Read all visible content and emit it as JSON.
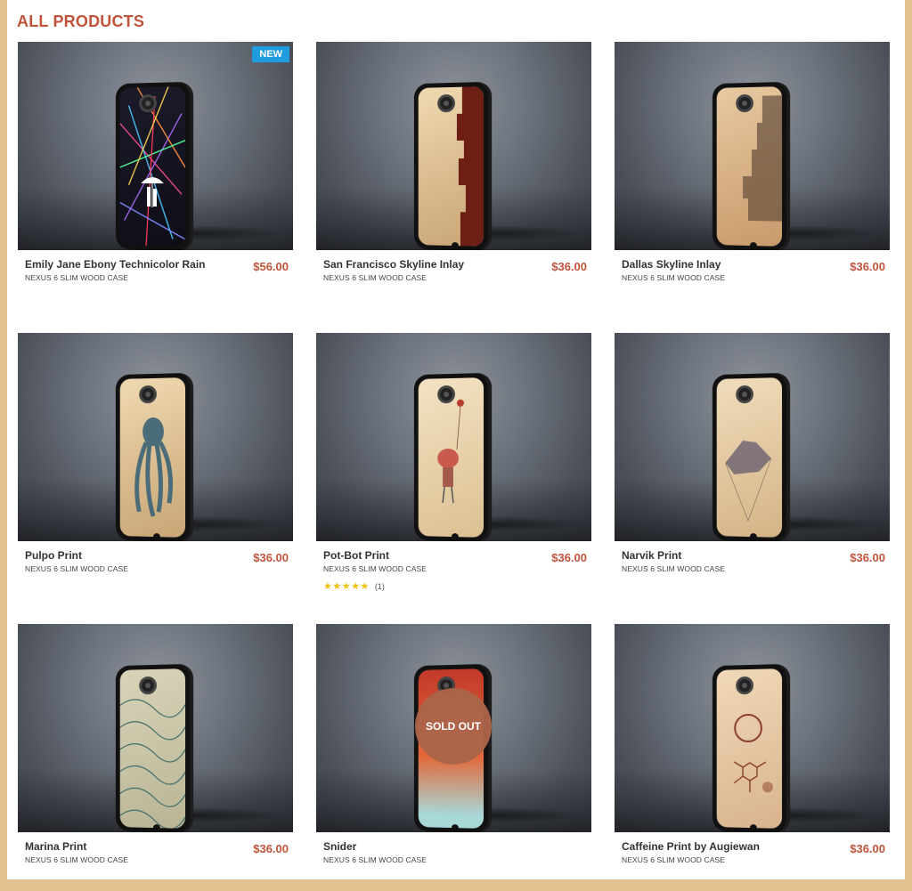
{
  "page": {
    "title": "ALL PRODUCTS"
  },
  "products": [
    {
      "name": "Emily Jane Ebony Technicolor Rain",
      "subtitle": "NEXUS 6 SLIM WOOD CASE",
      "price": "$56.00",
      "badge": "NEW"
    },
    {
      "name": "San Francisco Skyline Inlay",
      "subtitle": "NEXUS 6 SLIM WOOD CASE",
      "price": "$36.00"
    },
    {
      "name": "Dallas Skyline Inlay",
      "subtitle": "NEXUS 6 SLIM WOOD CASE",
      "price": "$36.00"
    },
    {
      "name": "Pulpo Print",
      "subtitle": "NEXUS 6 SLIM WOOD CASE",
      "price": "$36.00"
    },
    {
      "name": "Pot-Bot Print",
      "subtitle": "NEXUS 6 SLIM WOOD CASE",
      "price": "$36.00",
      "rating": {
        "stars": 5,
        "count_text": "(1)"
      }
    },
    {
      "name": "Narvik Print",
      "subtitle": "NEXUS 6 SLIM WOOD CASE",
      "price": "$36.00"
    },
    {
      "name": "Marina Print",
      "subtitle": "NEXUS 6 SLIM WOOD CASE",
      "price": "$36.00"
    },
    {
      "name": "Snider",
      "subtitle": "NEXUS 6 SLIM WOOD CASE",
      "price": "",
      "overlay": "SOLD OUT"
    },
    {
      "name": "Caffeine Print by Augiewan",
      "subtitle": "NEXUS 6 SLIM WOOD CASE",
      "price": "$36.00"
    }
  ],
  "colors": {
    "accent": "#c0533a",
    "badge": "#1f9be0",
    "sold_out": "#ab654a",
    "border_wood": "#e2c08f",
    "stars": "#f2c010"
  },
  "icons": {
    "star": "star-icon"
  }
}
